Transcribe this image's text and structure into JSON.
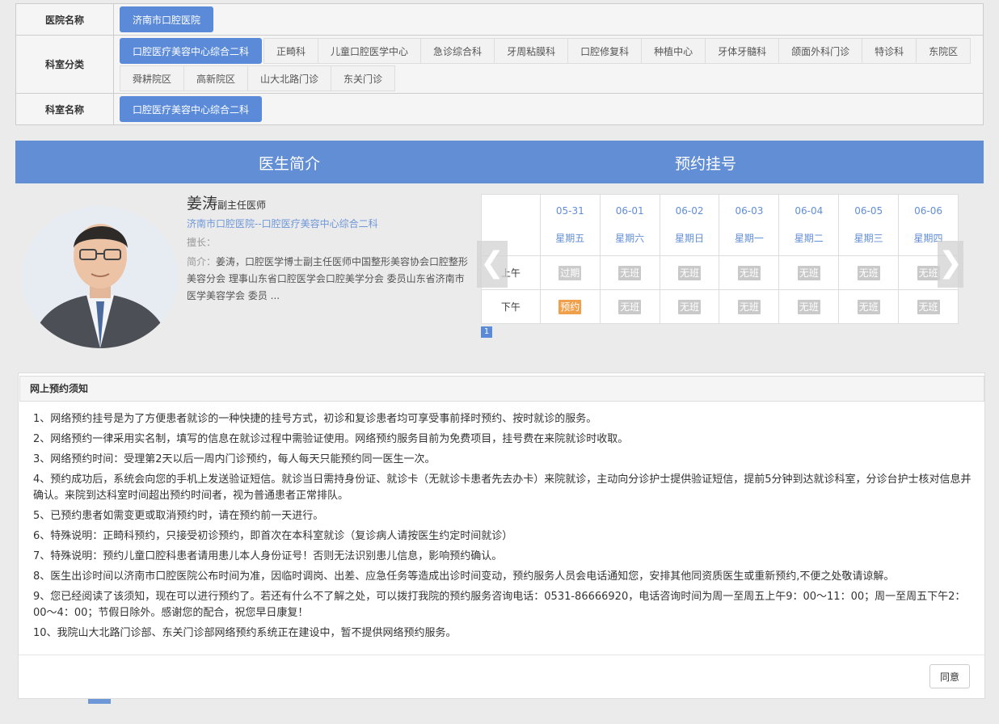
{
  "filter": {
    "hospital_label": "医院名称",
    "hospital_value": "济南市口腔医院",
    "dept_type_label": "科室分类",
    "dept_types": [
      "口腔医疗美容中心综合二科",
      "正畸科",
      "儿童口腔医学中心",
      "急诊综合科",
      "牙周粘膜科",
      "口腔修复科",
      "种植中心",
      "牙体牙髓科",
      "颌面外科门诊",
      "特诊科",
      "东院区",
      "舜耕院区",
      "高新院区",
      "山大北路门诊",
      "东关门诊"
    ],
    "dept_name_label": "科室名称",
    "dept_name_value": "口腔医疗美容中心综合二科"
  },
  "bar": {
    "left": "医生简介",
    "right": "预约挂号"
  },
  "doctor": {
    "name": "姜涛",
    "title": "副主任医师",
    "hospital_dept": "济南市口腔医院--口腔医疗美容中心综合二科",
    "specialty_label": "擅长：",
    "intro_label": "简介：",
    "intro": "姜涛，口腔医学博士副主任医师中国整形美容协会口腔整形美容分会 理事山东省口腔医学会口腔美学分会 委员山东省济南市医学美容学会 委员 ..."
  },
  "schedule": {
    "am_label": "上午",
    "pm_label": "下午",
    "days": [
      {
        "date": "05-31",
        "weekday": "星期五",
        "am": "过期",
        "pm": "预约"
      },
      {
        "date": "06-01",
        "weekday": "星期六",
        "am": "无班",
        "pm": "无班"
      },
      {
        "date": "06-02",
        "weekday": "星期日",
        "am": "无班",
        "pm": "无班"
      },
      {
        "date": "06-03",
        "weekday": "星期一",
        "am": "无班",
        "pm": "无班"
      },
      {
        "date": "06-04",
        "weekday": "星期二",
        "am": "无班",
        "pm": "无班"
      },
      {
        "date": "06-05",
        "weekday": "星期三",
        "am": "无班",
        "pm": "无班"
      },
      {
        "date": "06-06",
        "weekday": "星期四",
        "am": "无班",
        "pm": "无班"
      }
    ],
    "prev": "❮",
    "next": "❯",
    "page": "1"
  },
  "notice": {
    "title": "网上预约须知",
    "items": [
      "1、网络预约挂号是为了方便患者就诊的一种快捷的挂号方式，初诊和复诊患者均可享受事前择时预约、按时就诊的服务。",
      "2、网络预约一律采用实名制，填写的信息在就诊过程中需验证使用。网络预约服务目前为免费项目，挂号费在来院就诊时收取。",
      "3、网络预约时间：受理第2天以后一周内门诊预约，每人每天只能预约同一医生一次。",
      "4、预约成功后，系统会向您的手机上发送验证短信。就诊当日需持身份证、就诊卡（无就诊卡患者先去办卡）来院就诊，主动向分诊护士提供验证短信，提前5分钟到达就诊科室，分诊台护士核对信息并确认。来院到达科室时间超出预约时间者，视为普通患者正常排队。",
      "5、已预约患者如需变更或取消预约时，请在预约前一天进行。",
      "6、特殊说明：正畸科预约，只接受初诊预约，即首次在本科室就诊（复诊病人请按医生约定时间就诊）",
      "7、特殊说明：预约儿童口腔科患者请用患儿本人身份证号！否则无法识别患儿信息，影响预约确认。",
      "8、医生出诊时间以济南市口腔医院公布时间为准，因临时调岗、出差、应急任务等造成出诊时间变动，预约服务人员会电话通知您，安排其他同资质医生或重新预约,不便之处敬请谅解。",
      "9、您已经阅读了该须知，现在可以进行预约了。若还有什么不了解之处，可以拨打我院的预约服务咨询电话：0531-86666920，电话咨询时间为周一至周五上午9：00～11：00；周一至周五下午2：00～4：00；节假日除外。感谢您的配合，祝您早日康复！",
      "10、我院山大北路门诊部、东关门诊部网络预约系统正在建设中，暂不提供网络预约服务。"
    ],
    "agree": "同意"
  }
}
